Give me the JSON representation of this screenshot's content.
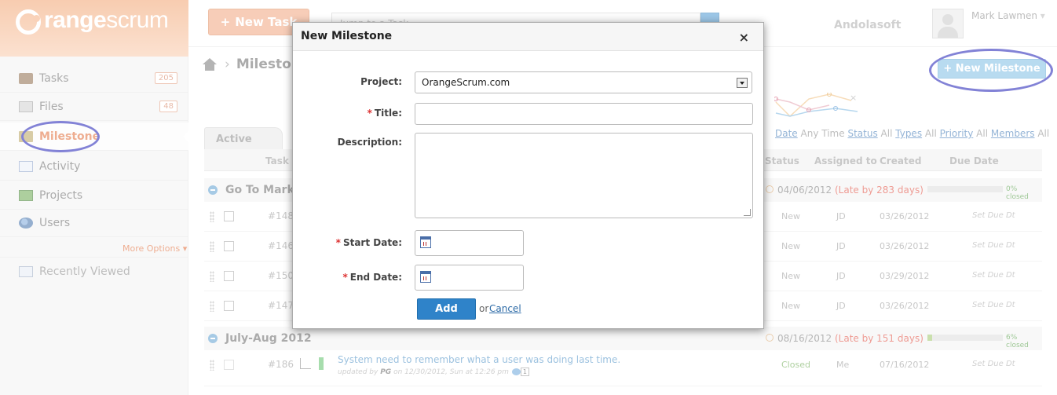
{
  "brand": {
    "logo_bold": "range",
    "logo_light": "scrum"
  },
  "sidebar": {
    "items": [
      {
        "label": "Tasks",
        "badge": "205"
      },
      {
        "label": "Files",
        "badge": "48"
      },
      {
        "label": "Milestone"
      },
      {
        "label": "Activity"
      },
      {
        "label": "Projects"
      },
      {
        "label": "Users"
      }
    ],
    "more_options": "More Options",
    "recently_viewed": "Recently Viewed"
  },
  "header": {
    "new_task": "New Task",
    "search_placeholder": "Jump to a Task",
    "company": "Andolasoft",
    "user_name": "Mark Lawmen"
  },
  "page": {
    "breadcrumb": "Milestone",
    "new_milestone": "+ New Milestone",
    "active_tab": "Active",
    "filters": {
      "date_label": "Date",
      "date_value": "Any Time",
      "status_label": "Status",
      "status_value": "All",
      "types_label": "Types",
      "types_value": "All",
      "priority_label": "Priority",
      "priority_value": "All",
      "members_label": "Members",
      "members_value": "All"
    },
    "columns": {
      "task": "Task",
      "status": "Status",
      "assigned_to": "Assigned to",
      "created": "Created",
      "due_date": "Due Date"
    }
  },
  "milestones": [
    {
      "name": "Go To Market",
      "date": "04/06/2012",
      "late": "(Late by 283 days)",
      "progress": 0,
      "progress_label": "0% closed",
      "tasks": [
        {
          "id": "#148",
          "status": "New",
          "assigned": "JD",
          "created": "03/26/2012",
          "due": "Set Due Dt"
        },
        {
          "id": "#146",
          "status": "New",
          "assigned": "JD",
          "created": "03/26/2012",
          "due": "Set Due Dt"
        },
        {
          "id": "#150",
          "status": "New",
          "assigned": "JD",
          "created": "03/29/2012",
          "due": "Set Due Dt"
        },
        {
          "id": "#147",
          "status": "New",
          "assigned": "JD",
          "created": "03/26/2012",
          "due": "Set Due Dt"
        }
      ]
    },
    {
      "name": "July-Aug 2012",
      "date": "08/16/2012",
      "late": "(Late by 151 days)",
      "progress": 6,
      "progress_label": "6% closed",
      "tasks": [
        {
          "id": "#186",
          "title": "System need to remember what a user was doing last time.",
          "updated_prefix": "updated by",
          "updated_by": "PG",
          "updated_on": "on 12/30/2012, Sun at 12:26 pm",
          "comments": "1",
          "status": "Closed",
          "assigned": "Me",
          "created": "07/16/2012",
          "due": "Set Due Dt"
        }
      ]
    }
  ],
  "modal": {
    "title": "New Milestone",
    "close": "×",
    "project_label": "Project:",
    "project_value": "OrangeScrum.com",
    "title_label": "Title:",
    "description_label": "Description:",
    "start_date_label": "Start Date:",
    "end_date_label": "End Date:",
    "required_marker": "*",
    "add": "Add",
    "or": "or",
    "cancel": "Cancel"
  },
  "colors": {
    "accent_orange": "#e06a36",
    "primary_blue": "#2f83c9",
    "annotation_blue": "#1d1db5",
    "late_red": "#e0493b"
  }
}
